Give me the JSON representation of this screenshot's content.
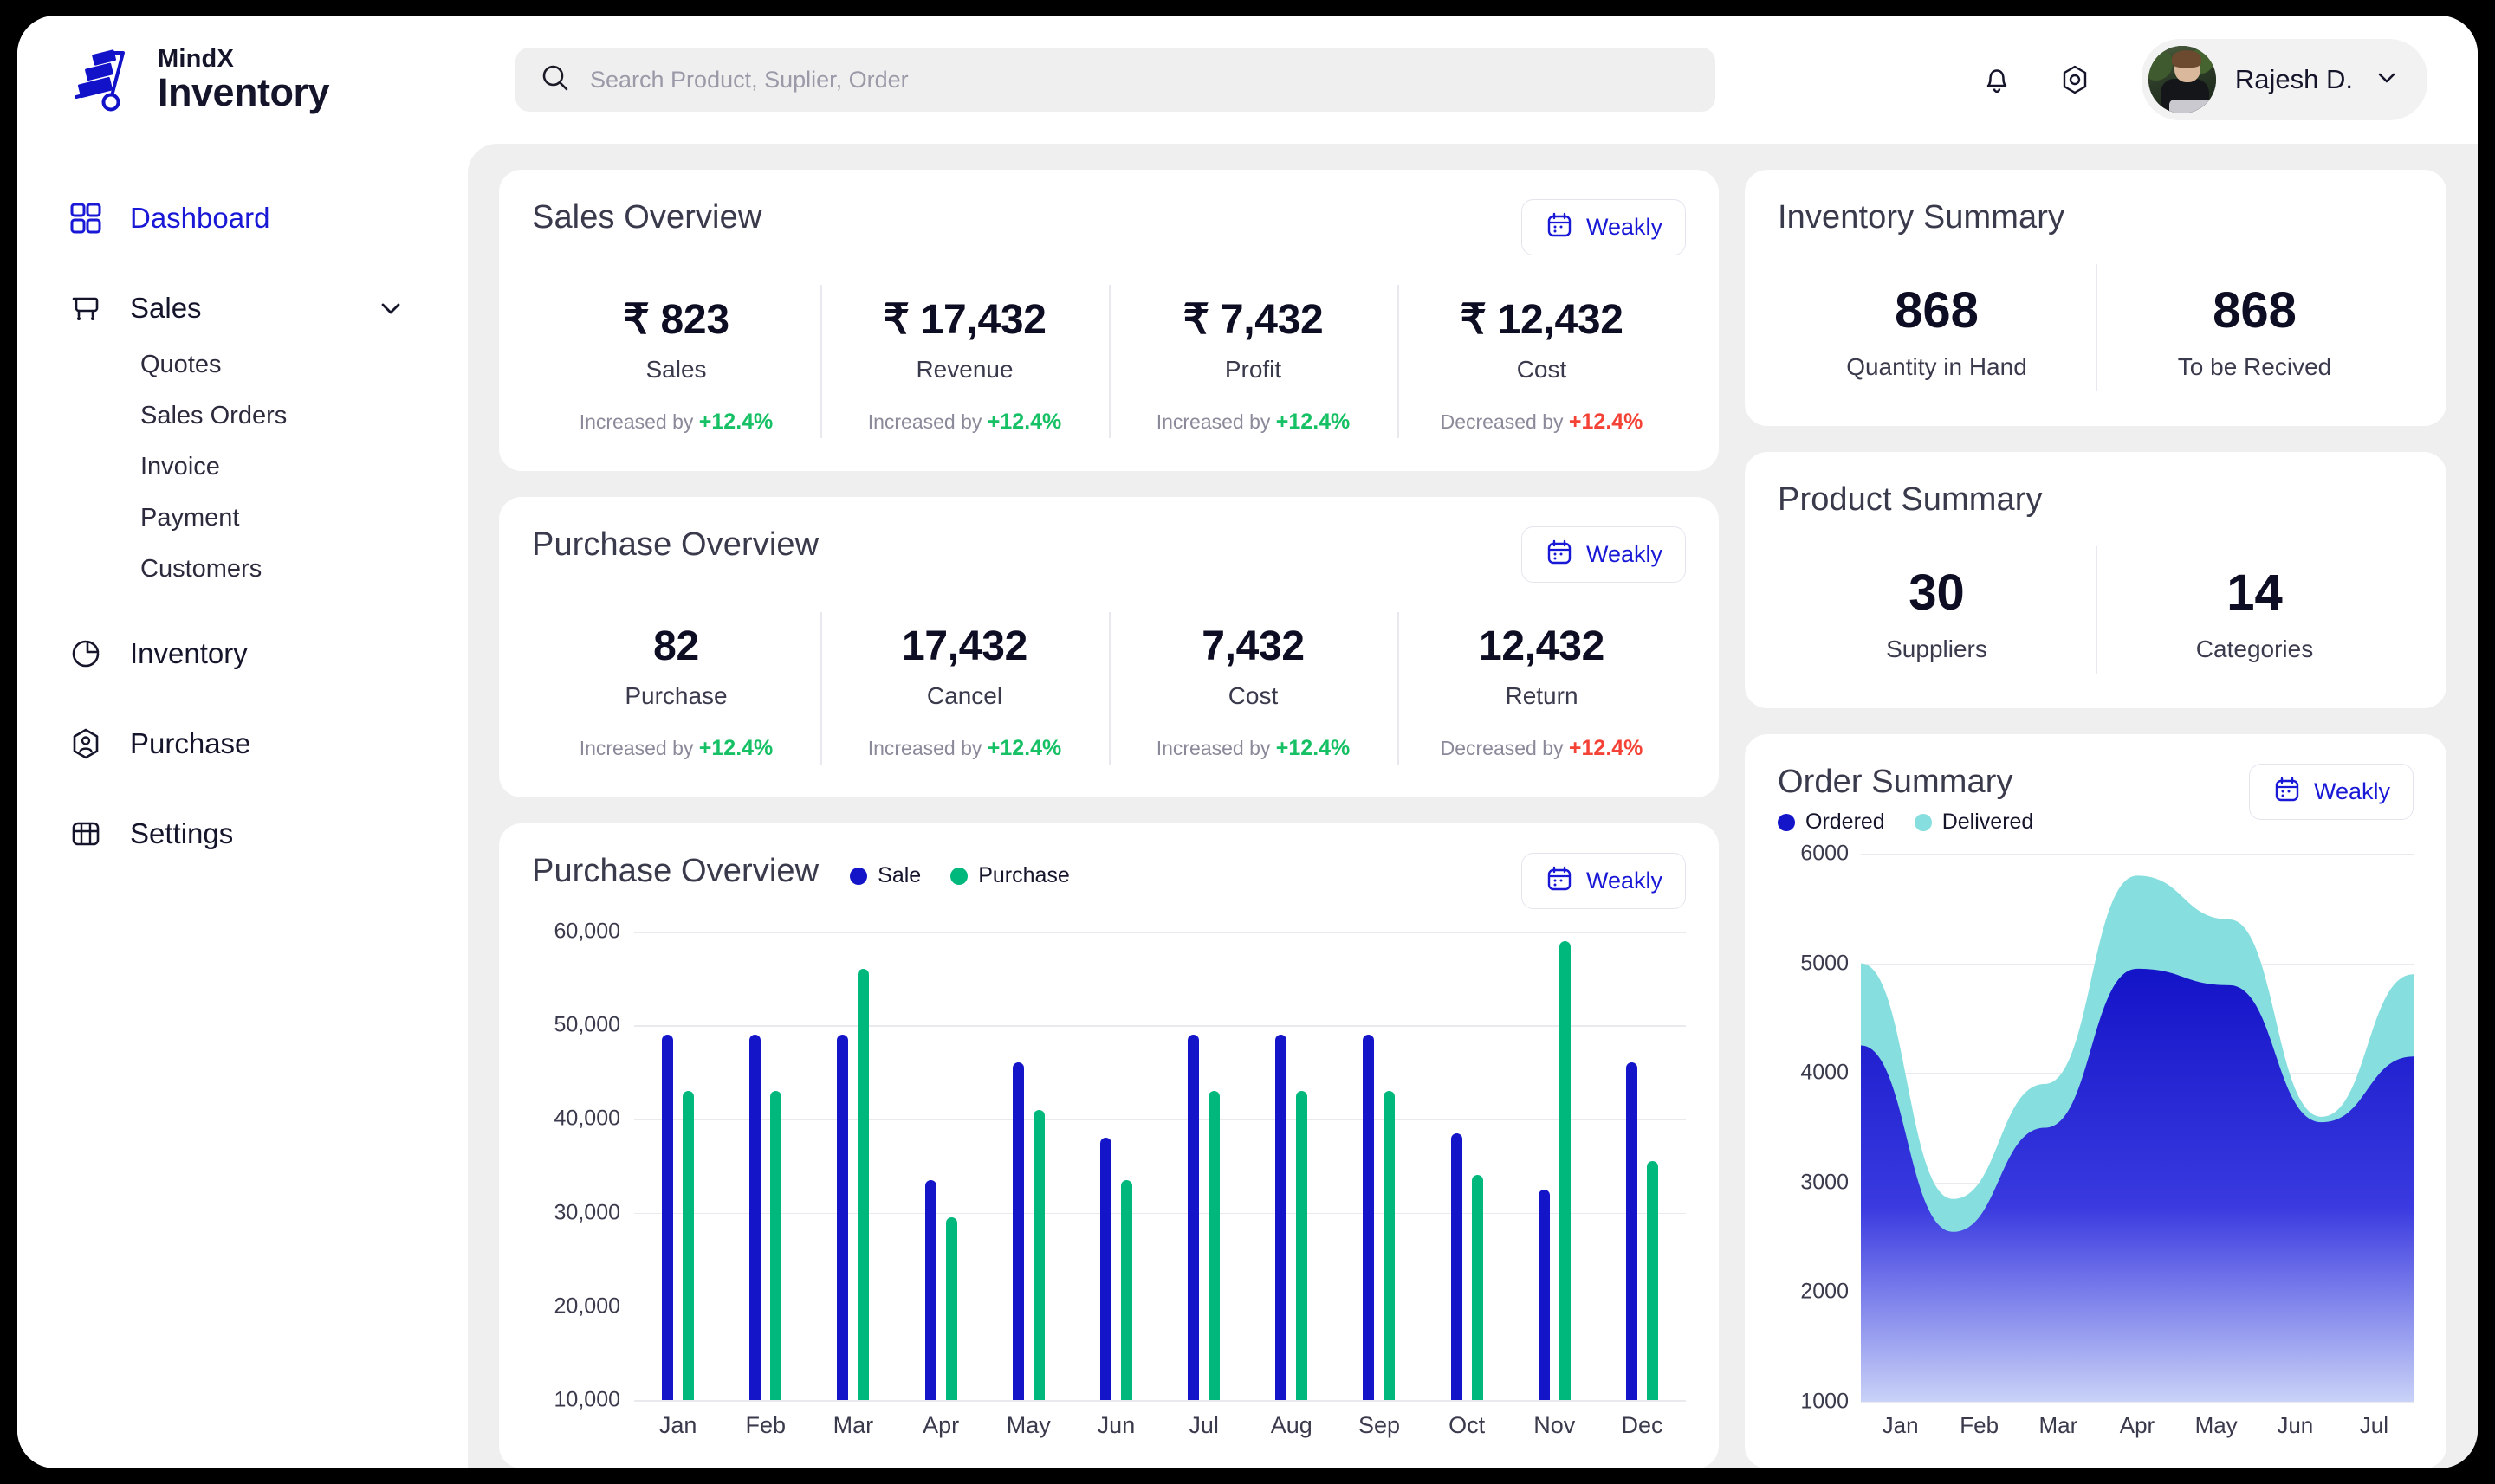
{
  "brand": {
    "top": "MindX",
    "bottom": "Inventory"
  },
  "search": {
    "placeholder": "Search Product, Suplier, Order",
    "value": ""
  },
  "user": {
    "name": "Rajesh D."
  },
  "sidebar": {
    "items": [
      {
        "label": "Dashboard",
        "icon": "grid-icon",
        "active": true
      },
      {
        "label": "Sales",
        "icon": "cart-icon",
        "expandable": true
      },
      {
        "label": "Inventory",
        "icon": "pie-chart-icon"
      },
      {
        "label": "Purchase",
        "icon": "user-hexagon-icon"
      },
      {
        "label": "Settings",
        "icon": "grid-box-icon"
      }
    ],
    "sales_sub": [
      "Quotes",
      "Sales Orders",
      "Invoice",
      "Payment",
      "Customers"
    ]
  },
  "period_label": "Weakly",
  "sales_overview": {
    "title": "Sales Overview",
    "stats": [
      {
        "value": "₹ 823",
        "label": "Sales",
        "delta_prefix": "Increased by",
        "delta": "+12.4%",
        "dir": "up"
      },
      {
        "value": "₹ 17,432",
        "label": "Revenue",
        "delta_prefix": "Increased by",
        "delta": "+12.4%",
        "dir": "up"
      },
      {
        "value": "₹ 7,432",
        "label": "Profit",
        "delta_prefix": "Increased by",
        "delta": "+12.4%",
        "dir": "up"
      },
      {
        "value": "₹ 12,432",
        "label": "Cost",
        "delta_prefix": "Decreased by",
        "delta": "+12.4%",
        "dir": "down"
      }
    ]
  },
  "purchase_overview": {
    "title": "Purchase Overview",
    "stats": [
      {
        "value": "82",
        "label": "Purchase",
        "delta_prefix": "Increased by",
        "delta": "+12.4%",
        "dir": "up"
      },
      {
        "value": "17,432",
        "label": "Cancel",
        "delta_prefix": "Increased by",
        "delta": "+12.4%",
        "dir": "up"
      },
      {
        "value": "7,432",
        "label": "Cost",
        "delta_prefix": "Increased by",
        "delta": "+12.4%",
        "dir": "up"
      },
      {
        "value": "12,432",
        "label": "Return",
        "delta_prefix": "Decreased by",
        "delta": "+12.4%",
        "dir": "down"
      }
    ]
  },
  "inventory_summary": {
    "title": "Inventory Summary",
    "cells": [
      {
        "value": "868",
        "label": "Quantity in Hand"
      },
      {
        "value": "868",
        "label": "To be Recived"
      }
    ]
  },
  "product_summary": {
    "title": "Product Summary",
    "cells": [
      {
        "value": "30",
        "label": "Suppliers"
      },
      {
        "value": "14",
        "label": "Categories"
      }
    ]
  },
  "colors": {
    "accent": "#1818d6",
    "sale": "#1414c8",
    "purchase": "#00b87c",
    "ordered": "#1414c8",
    "delivered": "#86dede",
    "up": "#16c064",
    "down": "#f44336",
    "content_bg": "#efefef"
  },
  "chart_data": [
    {
      "type": "bar",
      "title": "Purchase Overview",
      "categories": [
        "Jan",
        "Feb",
        "Mar",
        "Apr",
        "May",
        "Jun",
        "Jul",
        "Aug",
        "Sep",
        "Oct",
        "Nov",
        "Dec"
      ],
      "series": [
        {
          "name": "Sale",
          "color": "#1414c8",
          "values": [
            49000,
            49000,
            49000,
            33500,
            46000,
            38000,
            49000,
            49000,
            49000,
            38500,
            32500,
            46000
          ]
        },
        {
          "name": "Purchase",
          "color": "#00b87c",
          "values": [
            43000,
            43000,
            56000,
            29500,
            41000,
            33500,
            43000,
            43000,
            43000,
            34000,
            59000,
            35500
          ]
        }
      ],
      "ylabel": "",
      "xlabel": "",
      "ylim": [
        10000,
        60000
      ],
      "yticks": [
        "10,000",
        "20,000",
        "30,000",
        "40,000",
        "50,000",
        "60,000"
      ],
      "grid": true,
      "legend_position": "top-left"
    },
    {
      "type": "area",
      "title": "Order Summary",
      "categories": [
        "Jan",
        "Feb",
        "Mar",
        "Apr",
        "May",
        "Jun",
        "Jul"
      ],
      "series": [
        {
          "name": "Delivered",
          "color": "#86dede",
          "values": [
            5000,
            2850,
            3900,
            5800,
            5400,
            3600,
            4900
          ]
        },
        {
          "name": "Ordered",
          "color": "#1414c8",
          "values": [
            4250,
            2550,
            3500,
            4950,
            4800,
            3550,
            4150
          ]
        }
      ],
      "ylim": [
        1000,
        6000
      ],
      "yticks": [
        "1000",
        "2000",
        "3000",
        "4000",
        "5000",
        "6000"
      ],
      "grid": true,
      "legend_position": "top-left"
    }
  ]
}
